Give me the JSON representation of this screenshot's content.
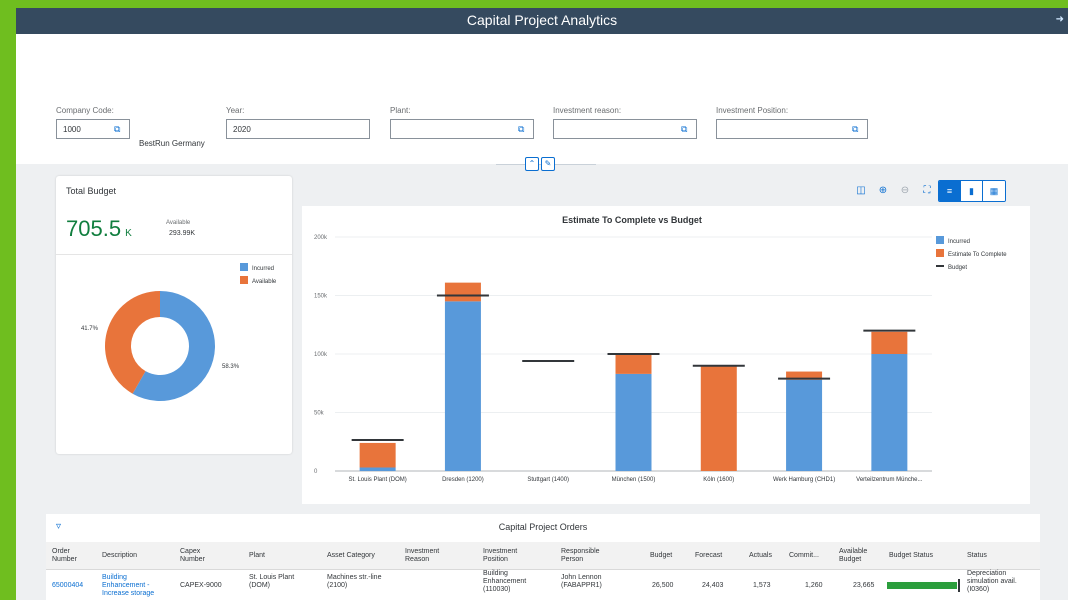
{
  "shell": {
    "title": "Capital Project Analytics",
    "icon": "logout-icon"
  },
  "filters": {
    "company_code": {
      "label": "Company Code:",
      "value": "1000",
      "name": "BestRun Germany"
    },
    "year": {
      "label": "Year:",
      "value": "2020"
    },
    "plant": {
      "label": "Plant:",
      "value": ""
    },
    "investment_reason": {
      "label": "Investment reason:",
      "value": ""
    },
    "investment_position": {
      "label": "Investment Position:",
      "value": ""
    }
  },
  "total_budget": {
    "title": "Total Budget",
    "value": "705.5",
    "unit": "K",
    "available_label": "Available",
    "available_value": "293.99K",
    "legend": [
      "Incurred",
      "Available"
    ],
    "slices": [
      {
        "name": "Incurred",
        "pct": 58.3,
        "label": "58.3%",
        "color": "#5899da"
      },
      {
        "name": "Available",
        "pct": 41.7,
        "label": "41.7%",
        "color": "#e8743b"
      }
    ]
  },
  "chart_data": {
    "type": "bar",
    "title": "Estimate To Complete vs Budget",
    "categories": [
      "St. Louis Plant (DOM)",
      "Dresden (1200)",
      "Stuttgart (1400)",
      "München (1500)",
      "Köln (1600)",
      "Werk Hamburg (CHD1)",
      "Verteilzentrum Münche..."
    ],
    "series": [
      {
        "name": "Incurred",
        "color": "#5899da",
        "values": [
          3000,
          145000,
          0,
          83000,
          0,
          78000,
          100000
        ]
      },
      {
        "name": "Estimate To Complete",
        "color": "#e8743b",
        "values": [
          21000,
          16000,
          0,
          17000,
          90000,
          7000,
          19000
        ]
      }
    ],
    "budget": {
      "name": "Budget",
      "color": "#32363a",
      "values": [
        26500,
        150000,
        94000,
        100000,
        90000,
        79000,
        120000
      ]
    },
    "yticks": [
      0,
      50000,
      100000,
      150000,
      200000
    ],
    "ytick_labels": [
      "0",
      "50k",
      "100k",
      "150k",
      "200k"
    ],
    "ylim": [
      0,
      200000
    ],
    "legend_position": "top-right"
  },
  "table": {
    "title": "Capital Project Orders",
    "columns": [
      "Order Number",
      "Description",
      "Capex Number",
      "Plant",
      "Asset Category",
      "Investment Reason",
      "Investment Position",
      "Responsible Person",
      "Budget",
      "Forecast",
      "Actuals",
      "Commit...",
      "Available Budget",
      "Budget Status",
      "Status"
    ],
    "rows": [
      {
        "order": "65000404",
        "description": "Building Enhancement - Increase storage",
        "capex": "CAPEX-9000",
        "plant": "St. Louis Plant (DOM)",
        "asset_category": "Machines str.-line (2100)",
        "investment_reason": "",
        "investment_position": "Building Enhancement (110030)",
        "responsible": "John Lennon (FABAPPR1)",
        "budget": "26,500",
        "forecast": "24,403",
        "actuals": "1,573",
        "commit": "1,260",
        "available": "23,665",
        "budget_status_pct": 97,
        "status": "Depreciation simulation avail. (I0360)"
      }
    ]
  }
}
